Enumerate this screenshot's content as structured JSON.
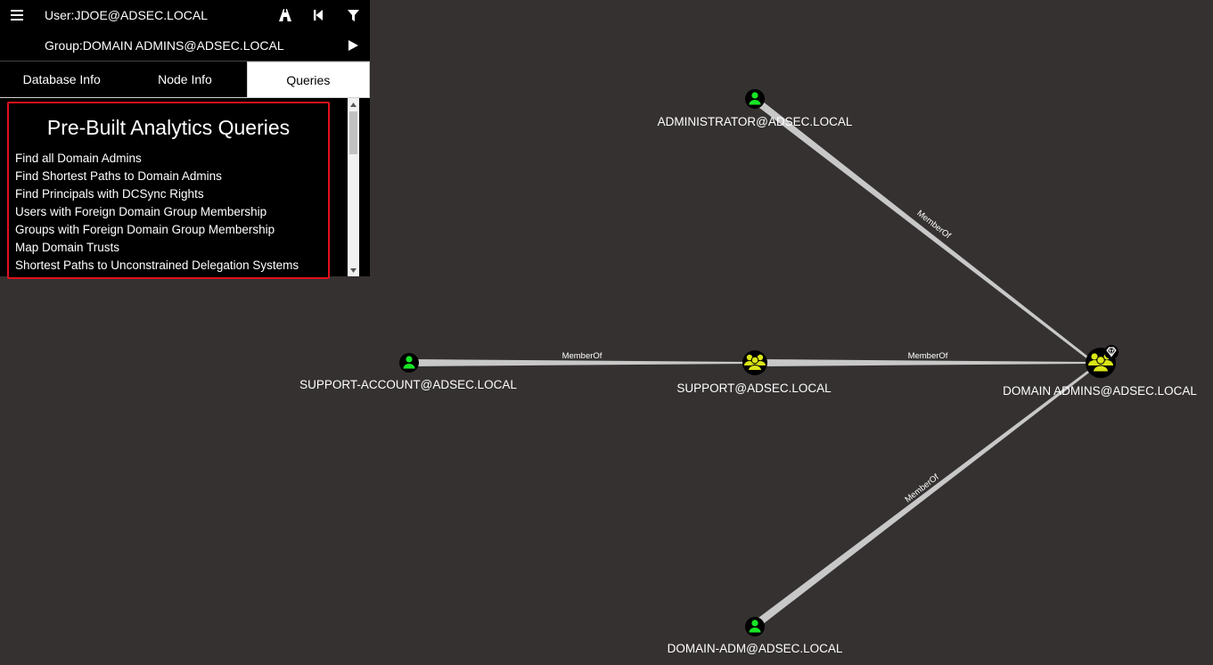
{
  "search": {
    "start_node": "User:JDOE@ADSEC.LOCAL",
    "target_node": "Group:DOMAIN ADMINS@ADSEC.LOCAL"
  },
  "icons": {
    "menu": "hamburger-menu-icon",
    "pathfinding": "road-icon",
    "back": "step-back-icon",
    "filter": "filter-icon",
    "play": "play-icon"
  },
  "tabs": [
    {
      "label": "Database Info",
      "active": false
    },
    {
      "label": "Node Info",
      "active": false
    },
    {
      "label": "Queries",
      "active": true
    }
  ],
  "queries": {
    "title": "Pre-Built Analytics Queries",
    "items": [
      "Find all Domain Admins",
      "Find Shortest Paths to Domain Admins",
      "Find Principals with DCSync Rights",
      "Users with Foreign Domain Group Membership",
      "Groups with Foreign Domain Group Membership",
      "Map Domain Trusts",
      "Shortest Paths to Unconstrained Delegation Systems"
    ]
  },
  "graph": {
    "nodes": {
      "administrator": {
        "label": "ADMINISTRATOR@ADSEC.LOCAL",
        "type": "user"
      },
      "support_account": {
        "label": "SUPPORT-ACCOUNT@ADSEC.LOCAL",
        "type": "user"
      },
      "support": {
        "label": "SUPPORT@ADSEC.LOCAL",
        "type": "group"
      },
      "domain_admins": {
        "label": "DOMAIN ADMINS@ADSEC.LOCAL",
        "type": "group",
        "high_value": true
      },
      "domain_adm": {
        "label": "DOMAIN-ADM@ADSEC.LOCAL",
        "type": "user"
      }
    },
    "edges": [
      {
        "from": "administrator",
        "to": "domain_admins",
        "label": "MemberOf"
      },
      {
        "from": "support_account",
        "to": "support",
        "label": "MemberOf"
      },
      {
        "from": "support",
        "to": "domain_admins",
        "label": "MemberOf"
      },
      {
        "from": "domain_adm",
        "to": "domain_admins",
        "label": "MemberOf"
      }
    ]
  },
  "colors": {
    "background": "#353131",
    "user_node": "#17e625",
    "group_node": "#dbe617",
    "edge": "#c8c8c8",
    "highlight_border": "#e0101c"
  }
}
